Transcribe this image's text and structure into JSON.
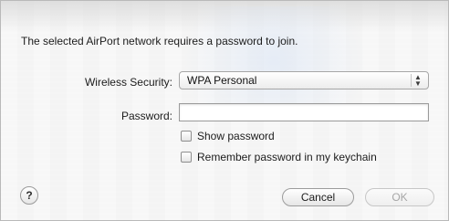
{
  "dialog": {
    "message": "The selected AirPort network requires a password to join."
  },
  "form": {
    "wireless_security_label": "Wireless Security:",
    "wireless_security_value": "WPA Personal",
    "password_label": "Password:",
    "password_value": "",
    "show_password_label": "Show password",
    "remember_password_label": "Remember password in my keychain"
  },
  "buttons": {
    "help_label": "?",
    "cancel_label": "Cancel",
    "ok_label": "OK"
  },
  "icons": {
    "select_arrows": "up-down-chevron-icon",
    "help": "question-mark-icon"
  }
}
